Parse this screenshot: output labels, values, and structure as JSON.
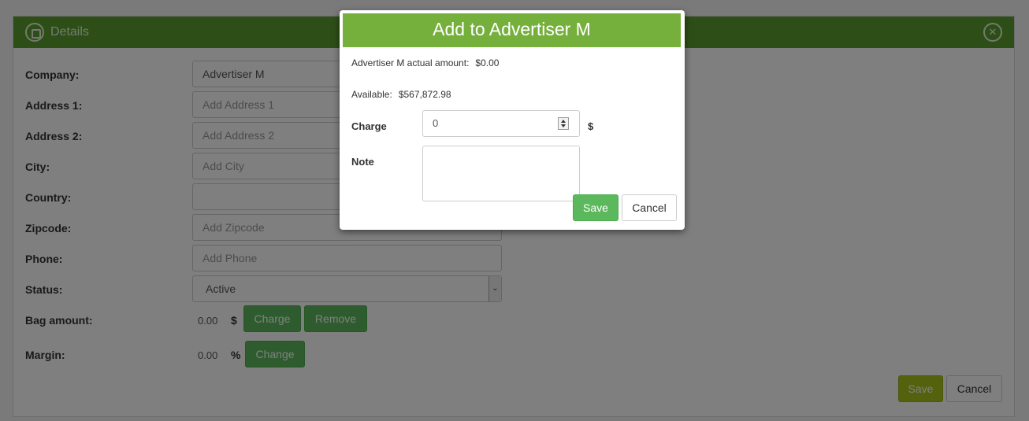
{
  "panel": {
    "title": "Details",
    "labels": {
      "company": "Company:",
      "address1": "Address 1:",
      "address2": "Address 2:",
      "city": "City:",
      "country": "Country:",
      "zipcode": "Zipcode:",
      "phone": "Phone:",
      "status": "Status:",
      "bag_amount": "Bag amount:",
      "margin": "Margin:"
    },
    "fields": {
      "company_value": "Advertiser M",
      "address1_placeholder": "Add Address 1",
      "address2_placeholder": "Add Address 2",
      "city_placeholder": "Add City",
      "country_value": "",
      "zipcode_placeholder": "Add Zipcode",
      "phone_placeholder": "Add Phone",
      "status_value": "Active"
    },
    "bag_amount": {
      "value": "0.00",
      "unit": "$",
      "charge_label": "Charge",
      "remove_label": "Remove"
    },
    "margin": {
      "value": "0.00",
      "unit": "%",
      "change_label": "Change"
    },
    "footer": {
      "save_label": "Save",
      "cancel_label": "Cancel"
    }
  },
  "modal": {
    "title": "Add to Advertiser M",
    "actual_amount_label": "Advertiser M actual amount:",
    "actual_amount_value": "$0.00",
    "available_label": "Available:",
    "available_value": "$567,872.98",
    "charge_label": "Charge",
    "charge_value": "0",
    "charge_unit": "$",
    "note_label": "Note",
    "note_value": "",
    "save_label": "Save",
    "cancel_label": "Cancel"
  },
  "colors": {
    "panel_header": "#5a9e2f",
    "modal_header": "#76b03c",
    "button_green": "#5cb85c",
    "button_olive": "#a9c21a"
  }
}
